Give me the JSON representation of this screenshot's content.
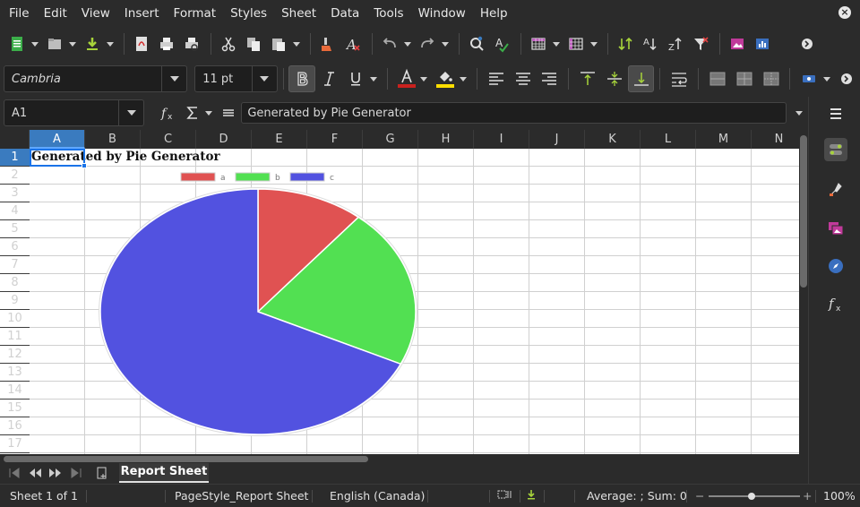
{
  "menu": [
    "File",
    "Edit",
    "View",
    "Insert",
    "Format",
    "Styles",
    "Sheet",
    "Data",
    "Tools",
    "Window",
    "Help"
  ],
  "font": {
    "name": "Cambria",
    "size": "11 pt"
  },
  "formula_bar": {
    "cell_ref": "A1",
    "content": "Generated by Pie Generator"
  },
  "columns": [
    "A",
    "B",
    "C",
    "D",
    "E",
    "F",
    "G",
    "H",
    "I",
    "J",
    "K",
    "L",
    "M",
    "N"
  ],
  "rows": [
    "1",
    "2",
    "3",
    "4",
    "5",
    "6",
    "7",
    "8",
    "9",
    "10",
    "11",
    "12",
    "13",
    "14",
    "15",
    "16",
    "17"
  ],
  "cells": {
    "A1": "Generated by Pie Generator"
  },
  "chart_data": {
    "type": "pie",
    "categories": [
      "a",
      "b",
      "c"
    ],
    "values": [
      11,
      21,
      68
    ],
    "colors": [
      "#e05252",
      "#52e052",
      "#5252e0"
    ],
    "legend": "top"
  },
  "sheet_tab": "Report Sheet",
  "status": {
    "sheet": "Sheet 1 of 1",
    "page_style": "PageStyle_Report Sheet",
    "language": "English (Canada)",
    "summary": "Average: ; Sum: 0",
    "zoom": "100%"
  },
  "colors": {
    "accent": "#3a7bbf",
    "selection": "#1a73e8"
  }
}
